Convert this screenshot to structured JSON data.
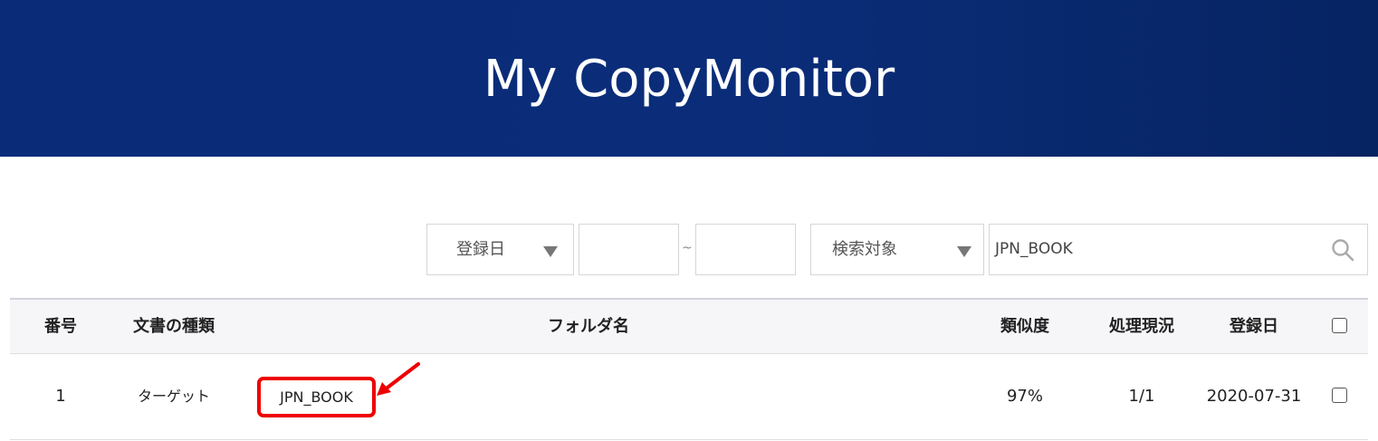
{
  "header": {
    "title": "My CopyMonitor"
  },
  "filters": {
    "date_select": {
      "selected": "登録日"
    },
    "date_from": {
      "value": ""
    },
    "date_separator": "~",
    "date_to": {
      "value": ""
    },
    "target_select": {
      "selected": "検索対象"
    },
    "search": {
      "value": "JPN_BOOK"
    }
  },
  "table": {
    "columns": {
      "number": "番号",
      "doc_type": "文書の種類",
      "folder": "フォルダ名",
      "similarity": "類似度",
      "status": "処理現況",
      "date": "登録日"
    },
    "rows": [
      {
        "number": "1",
        "doc_type": "ターゲット",
        "folder": "JPN_BOOK",
        "similarity": "97%",
        "status": "1/1",
        "date": "2020-07-31"
      }
    ]
  },
  "colors": {
    "header_bg": "#0b2d79",
    "highlight": "#ee0000",
    "table_header_bg": "#f6f6f9"
  }
}
